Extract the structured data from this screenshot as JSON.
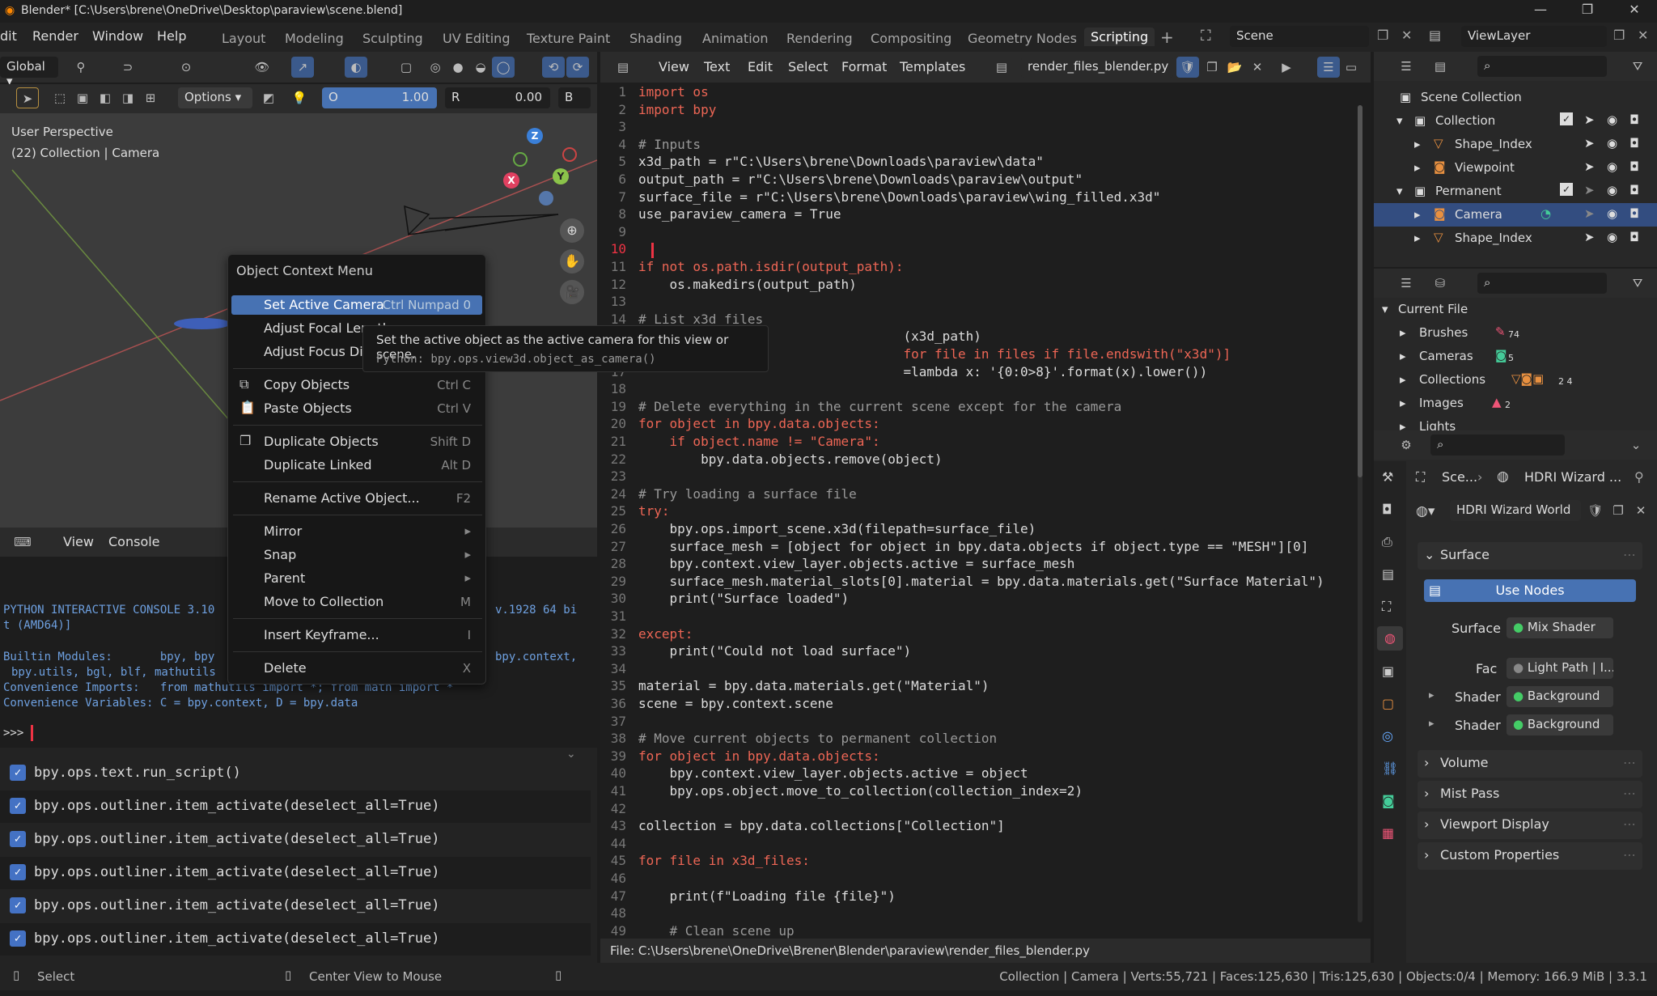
{
  "titlebar": {
    "title": "Blender* [C:\\Users\\brene\\OneDrive\\Desktop\\paraview\\scene.blend]"
  },
  "menubar": {
    "items": [
      "dit",
      "Render",
      "Window",
      "Help"
    ],
    "workspaces": [
      "Layout",
      "Modeling",
      "Sculpting",
      "UV Editing",
      "Texture Paint",
      "Shading",
      "Animation",
      "Rendering",
      "Compositing",
      "Geometry Nodes",
      "Scripting"
    ],
    "active_workspace": "Scripting",
    "scene": "Scene",
    "view_layer": "ViewLayer"
  },
  "viewport": {
    "orientation": "Global",
    "options_label": "Options",
    "o_label": "O",
    "o_value": "1.00",
    "r_label": "R",
    "r_value": "0.00",
    "b_label": "B",
    "overlay_line1": "User Perspective",
    "overlay_line2": "(22) Collection | Camera",
    "axis_x": "X",
    "axis_y": "Y",
    "axis_z": "Z"
  },
  "console": {
    "menu": [
      "View",
      "Console"
    ],
    "lines": [
      "PYTHON INTERACTIVE CONSOLE 3.10",
      "t (AMD64)]",
      "Builtin Modules:       bpy, bpy",
      "bpy.utils, bgl, blf, mathutils",
      "Convenience Imports:   from mathutils import *; from math import *",
      "Convenience Variables: C = bpy.context, D = bpy.data"
    ],
    "right_fragments": [
      "v.1928 64 bi",
      "bpy.context,"
    ],
    "prompt": ">>>"
  },
  "info_log": [
    "bpy.ops.text.run_script()",
    "bpy.ops.outliner.item_activate(deselect_all=True)",
    "bpy.ops.outliner.item_activate(deselect_all=True)",
    "bpy.ops.outliner.item_activate(deselect_all=True)",
    "bpy.ops.outliner.item_activate(deselect_all=True)",
    "bpy.ops.outliner.item_activate(deselect_all=True)"
  ],
  "text_editor": {
    "menu": [
      "View",
      "Text",
      "Edit",
      "Select",
      "Format",
      "Templates"
    ],
    "filename": "render_files_blender.py",
    "footer": "File: C:\\Users\\brene\\OneDrive\\Brener\\Blender\\paraview\\render_files_blender.py"
  },
  "code": [
    {
      "n": "1",
      "t": "import os"
    },
    {
      "n": "2",
      "t": "import bpy"
    },
    {
      "n": "3",
      "t": ""
    },
    {
      "n": "4",
      "t": "# Inputs"
    },
    {
      "n": "5",
      "t": "x3d_path = r\"C:\\Users\\brene\\Downloads\\paraview\\data\""
    },
    {
      "n": "6",
      "t": "output_path = r\"C:\\Users\\brene\\Downloads\\paraview\\output\""
    },
    {
      "n": "7",
      "t": "surface_file = r\"C:\\Users\\brene\\Downloads\\paraview\\wing_filled.x3d\""
    },
    {
      "n": "8",
      "t": "use_paraview_camera = True"
    },
    {
      "n": "9",
      "t": ""
    },
    {
      "n": "10",
      "t": ""
    },
    {
      "n": "11",
      "t": "if not os.path.isdir(output_path):"
    },
    {
      "n": "12",
      "t": "    os.makedirs(output_path)"
    },
    {
      "n": "13",
      "t": ""
    },
    {
      "n": "14",
      "t": "# List x3d files"
    },
    {
      "n": "15",
      "t": "                                  (x3d_path)"
    },
    {
      "n": "16",
      "t": "                                  for file in files if file.endswith(\"x3d\")]"
    },
    {
      "n": "17",
      "t": "                                  =lambda x: '{0:0>8}'.format(x).lower())"
    },
    {
      "n": "18",
      "t": ""
    },
    {
      "n": "19",
      "t": "# Delete everything in the current scene except for the camera"
    },
    {
      "n": "20",
      "t": "for object in bpy.data.objects:"
    },
    {
      "n": "21",
      "t": "    if object.name != \"Camera\":"
    },
    {
      "n": "22",
      "t": "        bpy.data.objects.remove(object)"
    },
    {
      "n": "23",
      "t": ""
    },
    {
      "n": "24",
      "t": "# Try loading a surface file"
    },
    {
      "n": "25",
      "t": "try:"
    },
    {
      "n": "26",
      "t": "    bpy.ops.import_scene.x3d(filepath=surface_file)"
    },
    {
      "n": "27",
      "t": "    surface_mesh = [object for object in bpy.data.objects if object.type == \"MESH\"][0]"
    },
    {
      "n": "28",
      "t": "    bpy.context.view_layer.objects.active = surface_mesh"
    },
    {
      "n": "29",
      "t": "    surface_mesh.material_slots[0].material = bpy.data.materials.get(\"Surface Material\")"
    },
    {
      "n": "30",
      "t": "    print(\"Surface loaded\")"
    },
    {
      "n": "31",
      "t": ""
    },
    {
      "n": "32",
      "t": "except:"
    },
    {
      "n": "33",
      "t": "    print(\"Could not load surface\")"
    },
    {
      "n": "34",
      "t": ""
    },
    {
      "n": "35",
      "t": "material = bpy.data.materials.get(\"Material\")"
    },
    {
      "n": "36",
      "t": "scene = bpy.context.scene"
    },
    {
      "n": "37",
      "t": ""
    },
    {
      "n": "38",
      "t": "# Move current objects to permanent collection"
    },
    {
      "n": "39",
      "t": "for object in bpy.data.objects:"
    },
    {
      "n": "40",
      "t": "    bpy.context.view_layer.objects.active = object"
    },
    {
      "n": "41",
      "t": "    bpy.ops.object.move_to_collection(collection_index=2)"
    },
    {
      "n": "42",
      "t": ""
    },
    {
      "n": "43",
      "t": "collection = bpy.data.collections[\"Collection\"]"
    },
    {
      "n": "44",
      "t": ""
    },
    {
      "n": "45",
      "t": "for file in x3d_files:"
    },
    {
      "n": "46",
      "t": ""
    },
    {
      "n": "47",
      "t": "    print(f\"Loading file {file}\")"
    },
    {
      "n": "48",
      "t": ""
    },
    {
      "n": "49",
      "t": "    # Clean scene up"
    }
  ],
  "context_menu": {
    "title": "Object Context Menu",
    "items": [
      {
        "label": "Set Active Camera",
        "shortcut": "Ctrl Numpad 0"
      },
      {
        "label": "Adjust Focal Length",
        "shortcut": ""
      },
      {
        "label": "Adjust Focus Distance",
        "shortcut": ""
      },
      {
        "label": "Copy Objects",
        "shortcut": "Ctrl C"
      },
      {
        "label": "Paste Objects",
        "shortcut": "Ctrl V"
      },
      {
        "label": "Duplicate Objects",
        "shortcut": "Shift D"
      },
      {
        "label": "Duplicate Linked",
        "shortcut": "Alt D"
      },
      {
        "label": "Rename Active Object...",
        "shortcut": "F2"
      },
      {
        "label": "Mirror",
        "shortcut": "▸"
      },
      {
        "label": "Snap",
        "shortcut": "▸"
      },
      {
        "label": "Parent",
        "shortcut": "▸"
      },
      {
        "label": "Move to Collection",
        "shortcut": "M"
      },
      {
        "label": "Insert Keyframe...",
        "shortcut": "I"
      },
      {
        "label": "Delete",
        "shortcut": "X"
      }
    ]
  },
  "tooltip": {
    "text": "Set the active object as the active camera for this view or scene.",
    "python": "Python: bpy.ops.view3d.object_as_camera()"
  },
  "outliner": {
    "root": "Scene Collection",
    "rows": [
      {
        "label": "Collection"
      },
      {
        "label": "Shape_Index"
      },
      {
        "label": "Viewpoint"
      },
      {
        "label": "Permanent"
      },
      {
        "label": "Camera"
      },
      {
        "label": "Shape_Index"
      }
    ]
  },
  "file_view": {
    "root": "Current File",
    "rows": [
      {
        "label": "Brushes",
        "count": "74"
      },
      {
        "label": "Cameras",
        "count": "5"
      },
      {
        "label": "Collections",
        "count": "2 4"
      },
      {
        "label": "Images",
        "count": "2"
      },
      {
        "label": "Lights",
        "count": ""
      }
    ]
  },
  "properties": {
    "breadcrumb_scene": "Sce...",
    "breadcrumb_world": "HDRI Wizard ...",
    "world_name": "HDRI Wizard World",
    "surface_panel": "Surface",
    "use_nodes": "Use Nodes",
    "surface_label": "Surface",
    "surface_value": "Mix Shader",
    "fac_label": "Fac",
    "fac_value": "Light Path | I...",
    "shader1_label": "Shader",
    "shader1_value": "Background",
    "shader2_label": "Shader",
    "shader2_value": "Background",
    "panels": [
      "Volume",
      "Mist Pass",
      "Viewport Display",
      "Custom Properties"
    ]
  },
  "statusbar": {
    "left1": "Select",
    "left2": "Center View to Mouse",
    "right": "Collection | Camera | Verts:55,721 | Faces:125,630 | Tris:125,630 | Objects:0/4 | Memory: 166.9 MiB | 3.3.1"
  }
}
